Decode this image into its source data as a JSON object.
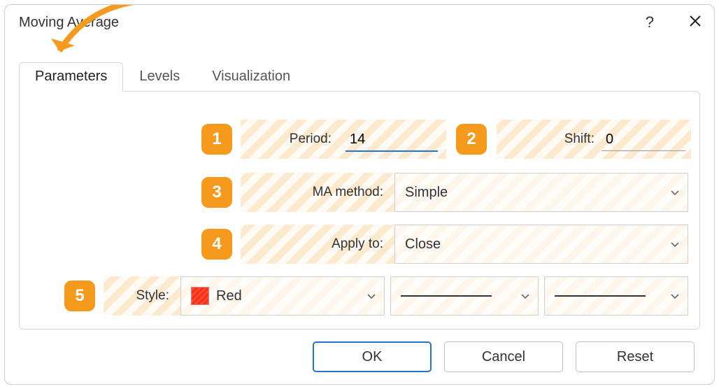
{
  "window": {
    "title": "Moving Average"
  },
  "tabs": [
    "Parameters",
    "Levels",
    "Visualization"
  ],
  "active_tab": 0,
  "badges": [
    "1",
    "2",
    "3",
    "4",
    "5"
  ],
  "fields": {
    "period": {
      "label": "Period:",
      "value": "14"
    },
    "shift": {
      "label": "Shift:",
      "value": "0"
    },
    "ma_method": {
      "label": "MA method:",
      "value": "Simple"
    },
    "apply_to": {
      "label": "Apply to:",
      "value": "Close"
    },
    "style": {
      "label": "Style:",
      "color_name": "Red",
      "color_hex": "#ff2b12"
    }
  },
  "buttons": {
    "ok": "OK",
    "cancel": "Cancel",
    "reset": "Reset"
  }
}
